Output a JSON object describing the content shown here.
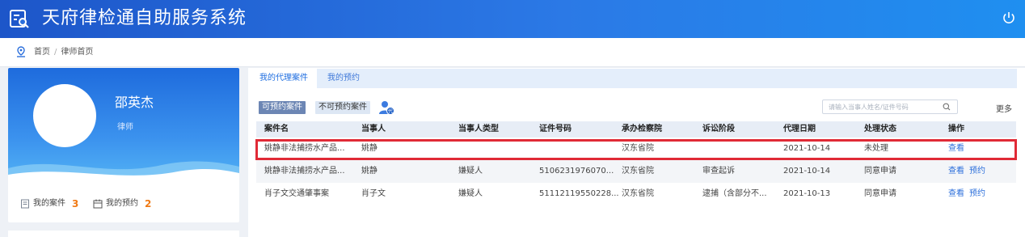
{
  "app": {
    "title": "天府律检通自助服务系统"
  },
  "breadcrumb": {
    "items": [
      "首页",
      "律师首页"
    ],
    "separator": "/"
  },
  "profile": {
    "name": "邵英杰",
    "role": "律师",
    "stats": [
      {
        "label": "我的案件",
        "count": "3",
        "icon": "document-icon"
      },
      {
        "label": "我的预约",
        "count": "2",
        "icon": "calendar-icon"
      }
    ]
  },
  "tabs": [
    {
      "label": "我的代理案件",
      "active": true
    },
    {
      "label": "我的预约",
      "active": false
    }
  ],
  "filters": [
    {
      "label": "可预约案件",
      "active": true
    },
    {
      "label": "不可预约案件",
      "active": false
    }
  ],
  "search": {
    "placeholder": "请输入当事人姓名/证件号码",
    "value": ""
  },
  "more_label": "更多",
  "table": {
    "headers": [
      "案件名",
      "当事人",
      "当事人类型",
      "证件号码",
      "承办检察院",
      "诉讼阶段",
      "代理日期",
      "处理状态",
      "操作"
    ],
    "rows": [
      {
        "case": "姚静非法捕捞水产品...",
        "party": "姚静",
        "party_type": "",
        "id_no": "",
        "procuratorate": "汉东省院",
        "stage": "",
        "date": "2021-10-14",
        "status": "未处理",
        "actions": [
          "查看"
        ]
      },
      {
        "case": "姚静非法捕捞水产品...",
        "party": "姚静",
        "party_type": "嫌疑人",
        "id_no": "5106231976070...",
        "procuratorate": "汉东省院",
        "stage": "审查起诉",
        "date": "2021-10-14",
        "status": "同意申请",
        "actions": [
          "查看",
          "预约"
        ]
      },
      {
        "case": "肖子文交通肇事案",
        "party": "肖子文",
        "party_type": "嫌疑人",
        "id_no": "51112119550228...",
        "procuratorate": "汉东省院",
        "stage": "逮捕（含部分不...",
        "date": "2021-10-13",
        "status": "同意申请",
        "actions": [
          "查看",
          "预约"
        ]
      }
    ]
  },
  "colors": {
    "header": "#2b79e6",
    "accent": "#1f6ee0",
    "count": "#f07b16",
    "highlight": "#e02a36"
  }
}
